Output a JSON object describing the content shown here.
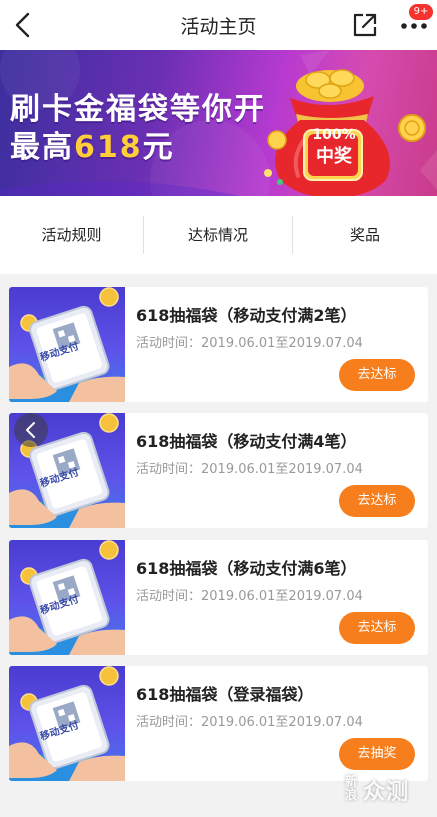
{
  "header": {
    "title": "活动主页",
    "badge": "9+"
  },
  "banner": {
    "line1": "刷卡金福袋等你开",
    "line2_prefix": "最高",
    "line2_amount": "618",
    "line2_suffix": "元",
    "bag_label_line1": "100%",
    "bag_label_line2": "中奖",
    "colors": {
      "accent_yellow": "#ffce3a",
      "bag_red": "#e8272d"
    }
  },
  "tabs": [
    {
      "label": "活动规则"
    },
    {
      "label": "达标情况"
    },
    {
      "label": "奖品"
    }
  ],
  "cards": [
    {
      "title": "618抽福袋（移动支付满2笔）",
      "time": "活动时间：2019.06.01至2019.07.04",
      "button": "去达标",
      "thumb_text": "移动支付"
    },
    {
      "title": "618抽福袋（移动支付满4笔）",
      "time": "活动时间：2019.06.01至2019.07.04",
      "button": "去达标",
      "thumb_text": "移动支付"
    },
    {
      "title": "618抽福袋（移动支付满6笔）",
      "time": "活动时间：2019.06.01至2019.07.04",
      "button": "去达标",
      "thumb_text": "移动支付"
    },
    {
      "title": "618抽福袋（登录福袋）",
      "time": "活动时间：2019.06.01至2019.07.04",
      "button": "去抽奖",
      "thumb_text": "移动支付"
    }
  ],
  "watermark": {
    "small": "新浪",
    "big": "众测"
  },
  "colors": {
    "button_orange": "#f77e1c",
    "badge_red": "#f5322e"
  }
}
